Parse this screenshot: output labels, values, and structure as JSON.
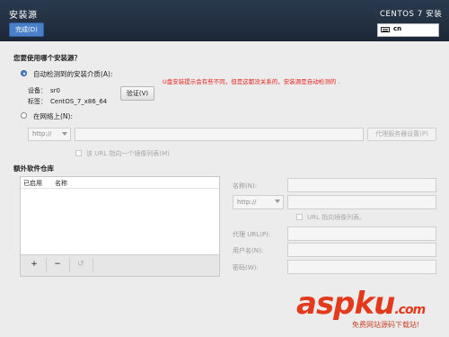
{
  "header": {
    "title": "安装源",
    "done_button": "完成(D)",
    "product": "CENTOS 7 安装",
    "keyboard_layout": "cn"
  },
  "source": {
    "question": "您要使用哪个安装源？",
    "auto_detect_label": "自动检测到的安装介质(A):",
    "device_key": "设备：",
    "device_value": "sr0",
    "label_key": "标签：",
    "label_value": "CentOS_7_x86_64",
    "verify_button": "验证(V)",
    "network_label": "在网络上(N):",
    "protocol": "http://",
    "proxy_button": "代理服务器设置(P)",
    "mirror_checkbox": "该 URL 指向一个镜像列表(M)",
    "annotation": "U盘安装提示会有些不同，但是这都没关系的，安装源是自动检测的 ."
  },
  "repos": {
    "section_title": "额外软件仓库",
    "columns": [
      "已启用",
      "名称"
    ],
    "add_button": "+",
    "remove_button": "−",
    "reset_button": "↺"
  },
  "repo_form": {
    "name_label": "名称(N):",
    "protocol": "http://",
    "mirror_checkbox": "URL 指向镜像列表。",
    "proxy_url_label": "代理 URL(P):",
    "username_label": "用户名(N):",
    "password_label": "密码(W):"
  },
  "watermark": {
    "brand_a": "asp",
    "brand_b": "ku",
    "brand_c": ".com",
    "subtitle": "免费网站源码下载站!"
  }
}
